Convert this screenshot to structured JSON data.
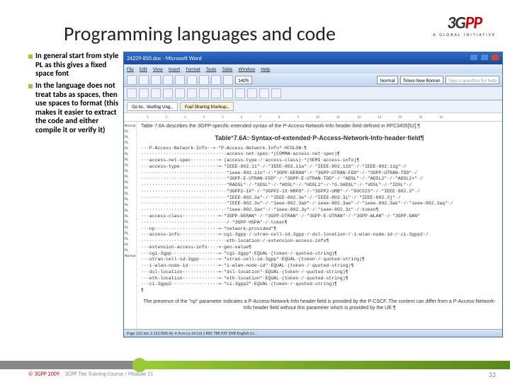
{
  "slide": {
    "title": "Programming languages and code",
    "page_number": "33"
  },
  "logo": {
    "brand_black": "3G",
    "brand_red": "PP",
    "tagline": "A GLOBAL INITIATIVE"
  },
  "bullets": [
    "In general start from style PL as this gives a fixed space font",
    "In the language does not treat tabs as spaces, then use spaces to format (this makes it easier to extract the code and either compile it or verify it)"
  ],
  "word": {
    "title": "24229-850.doc - Microsoft Word",
    "menus": [
      "File",
      "Edit",
      "View",
      "Insert",
      "Format",
      "Tools",
      "Table",
      "Window",
      "Help"
    ],
    "zoom": "140%",
    "style": "Normal",
    "font": "Times New Roman",
    "help_hint": "Type a question for help",
    "tabs": [
      "Go to.. Vesting Ung..",
      "Fuel Sharing Markup.."
    ],
    "ruler_marks": [
      "1",
      "2",
      "3",
      "4",
      "5",
      "6",
      "7",
      "8",
      "9",
      "10",
      "11",
      "12",
      "13",
      "14",
      "15",
      "16"
    ],
    "gutter_first": "Normal",
    "gutter_label": "PL",
    "gutter_last": "Normal",
    "doc_intro": "Table·7.6A·describes·the·3GPP-specific·extended·syntax·of·the·P-Access-Network-Info·header·field·defined·in RFC3455[52].¶",
    "doc_heading": "Table°7.6A:·Syntax-of-extended·P-Access-Network-Info·header·field¶",
    "code_lines": [
      "···P-Access-Network-Info··=·\"P-Access-Network-Info\"·HCOLON·¶",
      "·······························access·net·spec·*(COMMA·access·net·spec)¶",
      "···access-net-spec··········=·(access-type·/·access-class)·*(SEMI·access-info)¶",
      "···access-type··············=·\"IEEE-802.11\"·/·\"IEEE-802.11a\"·/·\"IEEE-802.11b\"·/·\"IEEE-802.11g\"·/",
      "·······························\"ieee-802.11n\"·/·\"3GPP-GERAN\"·/·\"3GPP-UTRAN-FDD\"·/·\"3GPP-UTRAN-TDD\"·/",
      "·······························\"3GPP-E-UTRAN-FDD\"·/·\"3GPP-E-UTRAN-TDD\"·/·\"ADSL\"·/·\"ADSL2\"·/·\"ADSL2+\"·/",
      "·······························\"RADSL\"·/·\"SDSL\"·/·\"HDSL\"·/·\"HDSL2\"·/·\"G.SHDSL\"·/·\"VDSL\"·/·\"IDSL\"·/",
      "·······························\"3GPP2-1X\"·/·\"3GPP2-1X·HRPD\"·/·\"3GPP2-UMB\"·/·\"DOCSIS\"·/·\"IEEE·802.3\"·/",
      "·······························\"IEEE-802.3a\"·/·\"IEEE-802.3e\"·/·\"IEEE-802.3i\"·/·\"IEEE-802.3j\"·/",
      "·······························\"IEEE-802.3u\"·/·\"ieee-802.3ab\"·/·ieee-802.3ae\"·/·\"ieee-802.3ak\"·/·\"ieee-802.3aq\"·/",
      "·······························\"ieee-802.3an\"·/·\"ieee-802.3y\"·/·\"ieee-802.3z\"·/·token¶",
      "···access-class·············=·\"3GPP-GERAN\"·/·\"3GPP-UTRAN\"·/·\"3GPP-E-UTRAN\"·/·\"3GPP-WLAN\"·/·\"3GPP-GAN\"",
      "·······························/·\"3GPP·HSPA\"·/·token¶",
      "···np·······················=·\"network-provided\"¶",
      "···access-info··············=·cgi-3gpp·/·utran-cell-id-3gpp·/·dsl-location·/·i-wlan-node-id·/·ci-3gpp2·/",
      "·······························eth-location·/·extension-access-info¶",
      "···extension-access-info····=·gen-value¶",
      "···cgi-3gpp·················=·\"cgi-3gpp\"·EQUAL·(token·/·quoted-string)¶",
      "···utran-cell-id-3gpp·······=·\"utran-cell-id-3gpp\"·EQUAL·(token·/·quoted-string)¶",
      "···i-wlan-node-id···········=·\"i-wlan-node-id\"·EQUAL·(token·/·quoted-string)¶",
      "···dsl-location·············=·\"dsl-location\"·EQUAL·(token·/·quoted-string)¶",
      "···eth-location·············=·\"eth-location\"·EQUAL·(token·/·quoted-string)¶",
      "···ci-3gpp2·················=·\"ci-3gpp2\"·EQUAL·(token·/·quoted-string)¶",
      "¶"
    ],
    "footnote": "The presence of the \"np\" parameter indicates a P-Access-Network-Info header field is provided by the P-CSCF. The content can differ from a P-Access-Network-Info header field without this parameter which is provided by the UE.¶",
    "statusbar": "Page 222   Sec 2   222/600   At: 4.9cm  Ln 24   Col 1   REC TRK EXT OVR  English (U..."
  },
  "footer": {
    "copyright": "© 3GPP 2009",
    "course": "3GPP The Training Course / Module 11"
  }
}
